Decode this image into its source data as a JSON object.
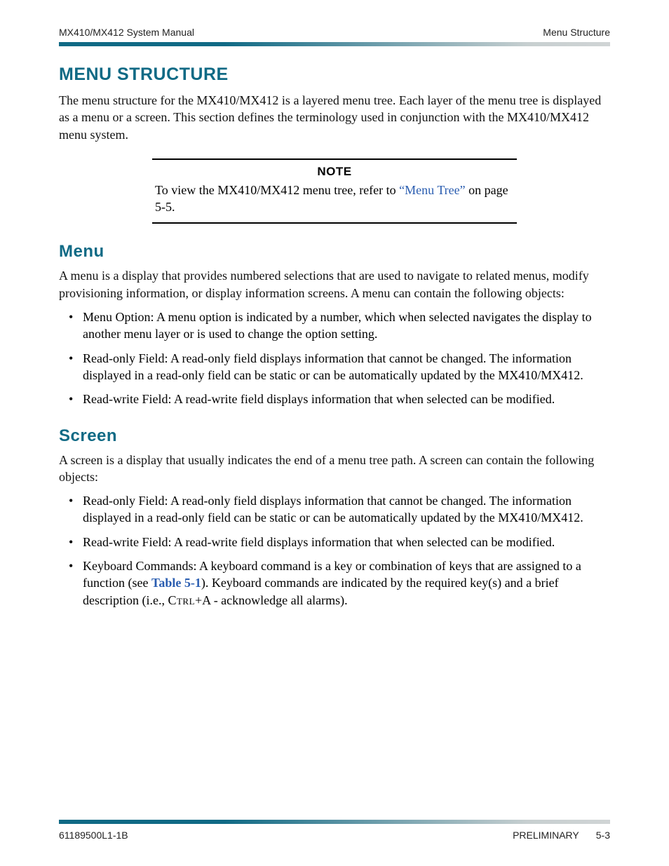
{
  "header": {
    "left": "MX410/MX412 System Manual",
    "right": "Menu Structure"
  },
  "section1": {
    "title": "MENU STRUCTURE",
    "para": "The menu structure for the MX410/MX412 is a layered menu tree. Each layer of the menu tree is displayed as a menu or a screen. This section defines the terminology used in conjunction with the MX410/MX412 menu system."
  },
  "note": {
    "label": "NOTE",
    "pre": "To view the MX410/MX412 menu tree, refer to ",
    "link": "“Menu Tree”",
    "post": " on page 5-5."
  },
  "menu": {
    "title": "Menu",
    "para": "A menu is a display that provides numbered selections that are used to navigate to related menus, modify provisioning information, or display information screens. A menu can contain the following objects:",
    "items": [
      "Menu Option: A menu option is indicated by a number, which when selected navigates the display to another menu layer or is used to change the option setting.",
      "Read-only Field: A read-only field displays information that cannot be changed. The information displayed in a read-only field can be static or can be automatically updated by the MX410/MX412.",
      "Read-write Field: A read-write field displays information that when selected can be modified."
    ]
  },
  "screen": {
    "title": "Screen",
    "para": "A screen is a display that usually indicates the end of a menu tree path. A screen can contain the following objects:",
    "items": [
      "Read-only Field: A read-only field displays information that cannot be changed. The information displayed in a read-only field can be static or can be automatically updated by the MX410/MX412.",
      "Read-write Field: A read-write field displays information that when selected can be modified."
    ],
    "kb_pre": "Keyboard Commands: A keyboard command is a key or combination of keys that are assigned to a function (see ",
    "kb_link": "Table 5-1",
    "kb_mid": "). Keyboard commands are indicated by the required key(s) and a brief description (i.e., ",
    "kb_sc": "Ctrl",
    "kb_post": "+A - acknowledge all alarms)."
  },
  "footer": {
    "left": "61189500L1-1B",
    "center": "PRELIMINARY",
    "right": "5-3"
  }
}
